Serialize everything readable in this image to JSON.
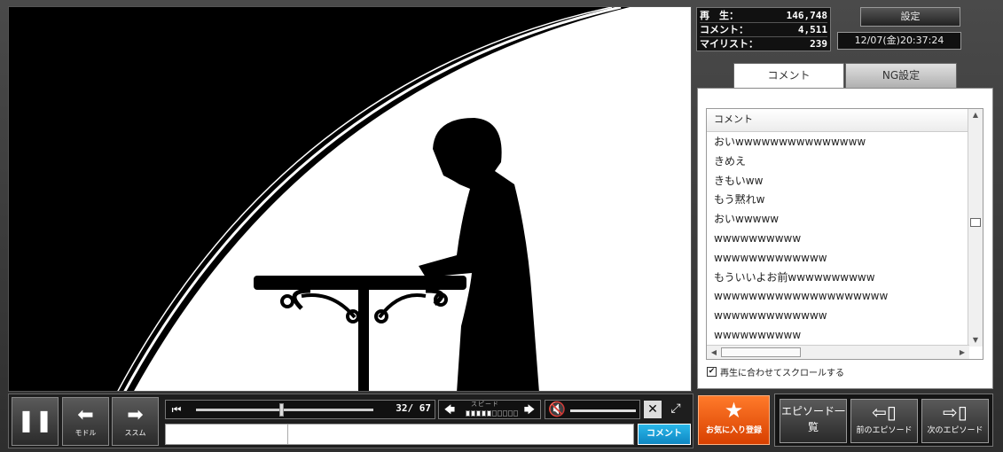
{
  "stats": {
    "play_label": "再　生：",
    "play_value": "146,748",
    "comment_label": "コメント：",
    "comment_value": "4,511",
    "mylist_label": "マイリスト：",
    "mylist_value": "239"
  },
  "settings_label": "設定",
  "datetime": "12/07(金)20:37:24",
  "tabs": {
    "comment": "コメント",
    "ng": "NG設定"
  },
  "comment_list": {
    "header": "コメント",
    "items": [
      "おいwwwwwwwwwwwwwww",
      "きめえ",
      "きもいww",
      "もう黙れw",
      "おいwwwww",
      "wwwwwwwwww",
      "wwwwwwwwwwwww",
      "もういいよお前wwwwwwwwww",
      "wwwwwwwwwwwwwwwwwwww",
      "wwwwwwwwwwwww",
      "wwwwwwwwww"
    ],
    "autoscroll_label": "再生に合わせてスクロールする",
    "autoscroll_checked": true
  },
  "controls": {
    "back_label": "モドル",
    "forward_label": "ススム",
    "time": "32/ 67",
    "progress": 0.48,
    "speed_label": "スピード",
    "speed_level": 5,
    "speed_max": 10,
    "comment_submit": "コメント"
  },
  "favorite_label": "お気に入り登録",
  "episodes": {
    "list_label": "エピソード一覧",
    "prev_label": "前のエピソード",
    "next_label": "次のエピソード"
  }
}
